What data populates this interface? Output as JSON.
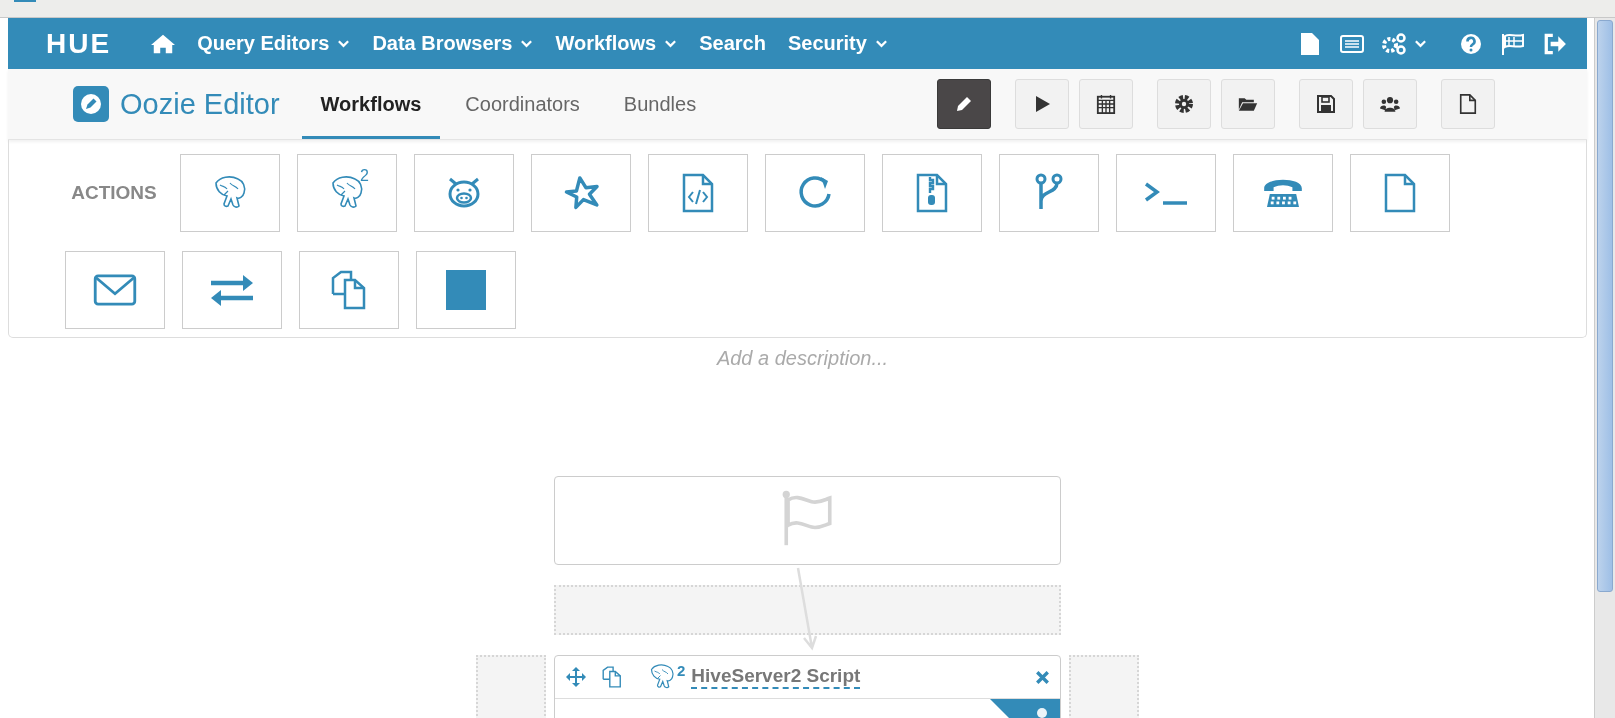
{
  "nav": {
    "logo": "HUE",
    "items": [
      {
        "label": "Query Editors",
        "dropdown": true
      },
      {
        "label": "Data Browsers",
        "dropdown": true
      },
      {
        "label": "Workflows",
        "dropdown": true
      },
      {
        "label": "Search",
        "dropdown": false
      },
      {
        "label": "Security",
        "dropdown": true
      }
    ]
  },
  "editor": {
    "title": "Oozie Editor",
    "tabs": [
      {
        "label": "Workflows",
        "selected": true
      },
      {
        "label": "Coordinators",
        "selected": false
      },
      {
        "label": "Bundles",
        "selected": false
      }
    ],
    "toolbar": [
      [
        {
          "kind": "edit",
          "selected": true
        }
      ],
      [
        {
          "kind": "play",
          "selected": false
        },
        {
          "kind": "calendar",
          "selected": false
        }
      ],
      [
        {
          "kind": "gear",
          "selected": false
        },
        {
          "kind": "folder",
          "selected": false
        }
      ],
      [
        {
          "kind": "save",
          "selected": false
        },
        {
          "kind": "users",
          "selected": false
        }
      ],
      [
        {
          "kind": "file",
          "selected": false
        }
      ]
    ]
  },
  "actions": {
    "label": "ACTIONS",
    "items": [
      {
        "kind": "hive"
      },
      {
        "kind": "hive",
        "badge": "2"
      },
      {
        "kind": "pig"
      },
      {
        "kind": "star"
      },
      {
        "kind": "code"
      },
      {
        "kind": "cycle"
      },
      {
        "kind": "zip"
      },
      {
        "kind": "branch"
      },
      {
        "kind": "terminal"
      },
      {
        "kind": "phone"
      },
      {
        "kind": "file"
      },
      {
        "kind": "mail"
      },
      {
        "kind": "exchange"
      },
      {
        "kind": "copy"
      },
      {
        "kind": "square"
      }
    ]
  },
  "description": {
    "placeholder": "Add a description..."
  },
  "canvas": {
    "node": {
      "title": "HiveServer2 Script",
      "badge": "2"
    }
  }
}
